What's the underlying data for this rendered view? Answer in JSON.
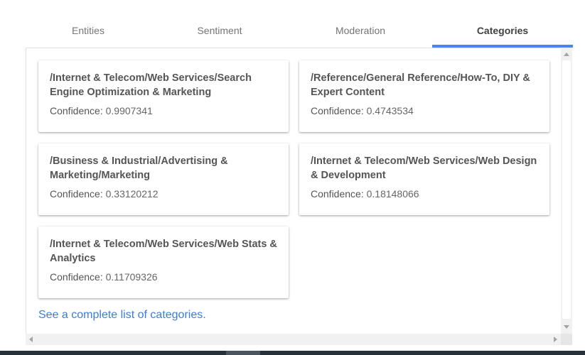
{
  "tabs": [
    {
      "label": "Entities",
      "active": false
    },
    {
      "label": "Sentiment",
      "active": false
    },
    {
      "label": "Moderation",
      "active": false
    },
    {
      "label": "Categories",
      "active": true
    }
  ],
  "categories": [
    {
      "name": "/Internet & Telecom/Web Services/Search Engine Optimization & Marketing",
      "confidence_label": "Confidence:",
      "confidence": "0.9907341"
    },
    {
      "name": "/Reference/General Reference/How-To, DIY & Expert Content",
      "confidence_label": "Confidence:",
      "confidence": "0.4743534"
    },
    {
      "name": "/Business & Industrial/Advertising & Marketing/Marketing",
      "confidence_label": "Confidence:",
      "confidence": "0.33120212"
    },
    {
      "name": "/Internet & Telecom/Web Services/Web Design & Development",
      "confidence_label": "Confidence:",
      "confidence": "0.18148066"
    },
    {
      "name": "/Internet & Telecom/Web Services/Web Stats & Analytics",
      "confidence_label": "Confidence:",
      "confidence": "0.11709326"
    }
  ],
  "footer_link": "See a complete list of categories.",
  "colors": {
    "accent": "#4a86e8",
    "link": "#3b7ddd"
  }
}
